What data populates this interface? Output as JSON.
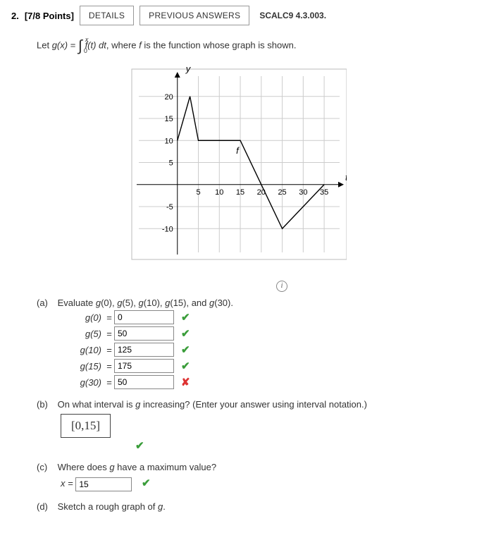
{
  "header": {
    "number": "2.",
    "points": "[7/8 Points]",
    "details_btn": "DETAILS",
    "prev_btn": "PREVIOUS ANSWERS",
    "ref": "SCALC9 4.3.003."
  },
  "prompt": {
    "pre": "Let ",
    "gx": "g(x)",
    "eq": " = ",
    "upper": "x",
    "lower": "0",
    "integrand": "f(t) dt",
    "post": ", where f is the function whose graph is shown."
  },
  "chart_data": {
    "type": "line",
    "title": "",
    "xlabel": "t",
    "ylabel": "y",
    "x_ticks": [
      5,
      10,
      15,
      20,
      25,
      30,
      35
    ],
    "y_ticks": [
      -10,
      -5,
      5,
      10,
      15,
      20
    ],
    "xlim": [
      -5,
      37
    ],
    "ylim": [
      -13,
      23
    ],
    "series": [
      {
        "name": "f",
        "points": [
          [
            0,
            10
          ],
          [
            3,
            20
          ],
          [
            5,
            10
          ],
          [
            15,
            10
          ],
          [
            25,
            -10
          ],
          [
            35,
            0
          ]
        ]
      }
    ],
    "label_pos": {
      "f": [
        14,
        7
      ]
    }
  },
  "parts": {
    "a": {
      "label": "(a)",
      "text": "Evaluate g(0), g(5), g(10), g(15), and g(30).",
      "rows": [
        {
          "lhs": "g(0)",
          "value": "0",
          "status": "ok"
        },
        {
          "lhs": "g(5)",
          "value": "50",
          "status": "ok"
        },
        {
          "lhs": "g(10)",
          "value": "125",
          "status": "ok"
        },
        {
          "lhs": "g(15)",
          "value": "175",
          "status": "ok"
        },
        {
          "lhs": "g(30)",
          "value": "50",
          "status": "bad"
        }
      ]
    },
    "b": {
      "label": "(b)",
      "text": "On what interval is g increasing? (Enter your answer using interval notation.)",
      "answer": "[0,15]",
      "status": "ok"
    },
    "c": {
      "label": "(c)",
      "text": "Where does g have a maximum value?",
      "lhs": "x = ",
      "value": "15",
      "status": "ok"
    },
    "d": {
      "label": "(d)",
      "text": "Sketch a rough graph of g."
    }
  },
  "marks": {
    "ok": "✔",
    "bad": "✘"
  },
  "info_icon": "i"
}
